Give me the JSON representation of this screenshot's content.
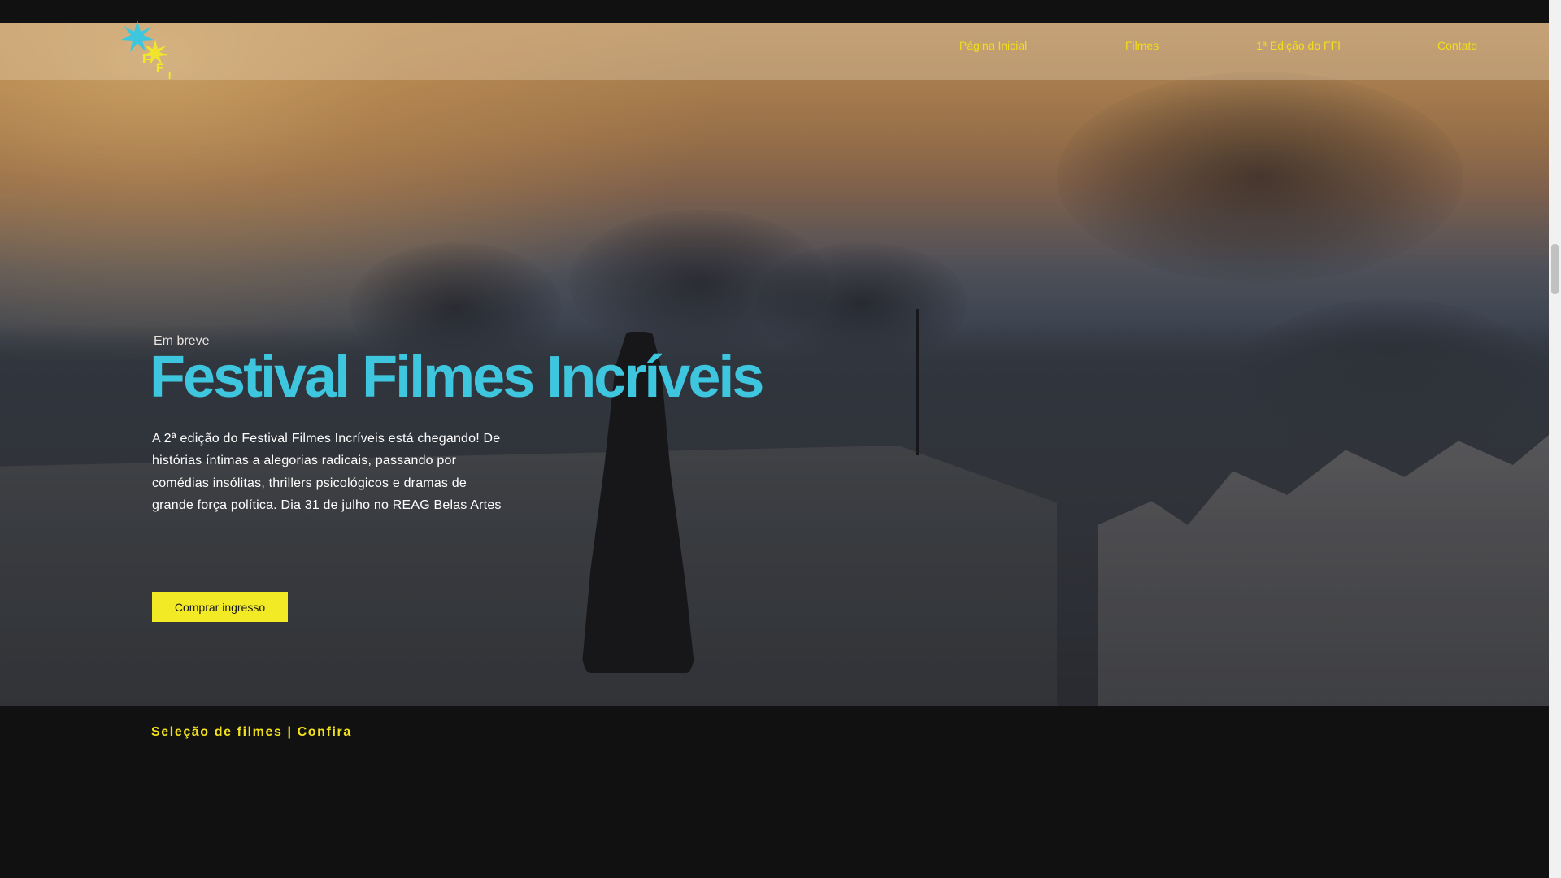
{
  "nav": {
    "logo_letters": [
      "F",
      "F",
      "I"
    ],
    "items": [
      {
        "label": "Página Inicial"
      },
      {
        "label": "Filmes"
      },
      {
        "label": "1ª Edição do FFI"
      },
      {
        "label": "Contato"
      }
    ]
  },
  "hero": {
    "kicker": "Em breve",
    "title": "Festival Filmes Incríveis",
    "description": "A 2ª edição do Festival Filmes Incríveis está chegando! De histórias íntimas a alegorias radicais, passando por comédias insólitas, thrillers psicológicos e dramas de grande força política. Dia 31 de julho no REAG Belas Artes",
    "cta_label": "Comprar ingresso"
  },
  "section": {
    "title": "Seleção de filmes | Confira"
  },
  "colors": {
    "accent_yellow": "#f3ea26",
    "title_cyan": "#3fc6df",
    "background": "#111111"
  }
}
